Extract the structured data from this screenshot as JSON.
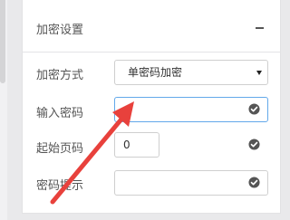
{
  "section": {
    "title": "加密设置"
  },
  "fields": {
    "encryption_method": {
      "label": "加密方式",
      "selected": "单密码加密"
    },
    "password": {
      "label": "输入密码",
      "value": ""
    },
    "start_page": {
      "label": "起始页码",
      "value": "0"
    },
    "password_hint": {
      "label": "密码提示",
      "value": ""
    }
  },
  "icons": {
    "collapse": "minus-icon",
    "select_caret": "chevron-down-icon",
    "validation": "check-circle-icon",
    "annotation": "red-arrow"
  },
  "colors": {
    "focus_border": "#62a8ea",
    "annotation_arrow": "#e8413c",
    "check_icon": "#555555"
  }
}
